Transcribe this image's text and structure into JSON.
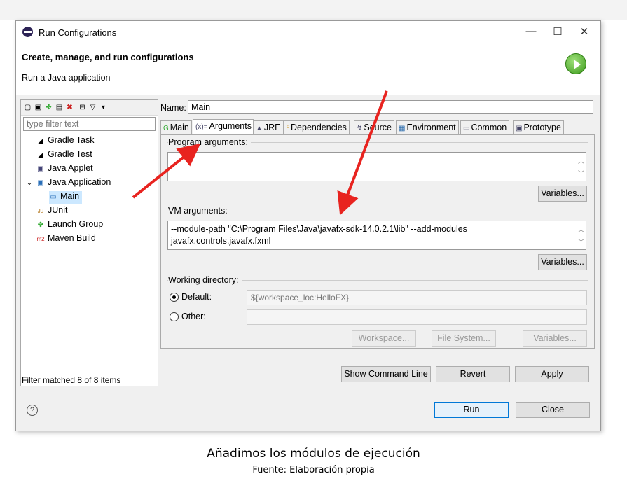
{
  "window": {
    "title": "Run Configurations",
    "minimize": "—",
    "maximize": "☐",
    "close": "✕"
  },
  "header": {
    "title": "Create, manage, and run configurations",
    "subtitle": "Run a Java application"
  },
  "left": {
    "filter_placeholder": "type filter text",
    "items": [
      {
        "label": "Gradle Task",
        "icon": "gradle-task-icon",
        "glyph": "◢"
      },
      {
        "label": "Gradle Test",
        "icon": "gradle-test-icon",
        "glyph": "◢"
      },
      {
        "label": "Java Applet",
        "icon": "java-applet-icon",
        "glyph": "▣"
      },
      {
        "label": "Java Application",
        "icon": "java-application-icon",
        "glyph": "▣",
        "expander": "⌄"
      },
      {
        "label": "Main",
        "icon": "java-main-icon",
        "glyph": "▭"
      },
      {
        "label": "JUnit",
        "icon": "junit-icon",
        "glyph": "Ju"
      },
      {
        "label": "Launch Group",
        "icon": "launch-group-icon",
        "glyph": "✤"
      },
      {
        "label": "Maven Build",
        "icon": "maven-icon",
        "glyph": "m2"
      }
    ],
    "status": "Filter matched 8 of 8 items"
  },
  "config": {
    "name_label": "Name:",
    "name_value": "Main",
    "tabs": [
      {
        "label": "Main",
        "glyph": "G"
      },
      {
        "label": "Arguments",
        "glyph": "(x)="
      },
      {
        "label": "JRE",
        "glyph": "▲"
      },
      {
        "label": "Dependencies",
        "glyph": "⁰"
      },
      {
        "label": "Source",
        "glyph": "↯"
      },
      {
        "label": "Environment",
        "glyph": "▦"
      },
      {
        "label": "Common",
        "glyph": "▭"
      },
      {
        "label": "Prototype",
        "glyph": "▣"
      }
    ],
    "program_args_label": "Program arguments:",
    "program_args_value": "",
    "variables_label": "Variables...",
    "vm_args_label": "VM arguments:",
    "vm_args_line1": "--module-path \"C:\\Program Files\\Java\\javafx-sdk-14.0.2.1\\lib\" --add-modules",
    "vm_args_line2": "javafx.controls,javafx.fxml",
    "working_dir_label": "Working directory:",
    "default_label": "Default:",
    "default_value": "${workspace_loc:HelloFX}",
    "other_label": "Other:",
    "workspace_btn": "Workspace...",
    "filesystem_btn": "File System...",
    "variables_btn": "Variables..."
  },
  "buttons": {
    "show_command_line": "Show Command Line",
    "revert": "Revert",
    "apply": "Apply",
    "run": "Run",
    "close": "Close",
    "help": "?"
  },
  "caption": {
    "title": "Añadimos los módulos de ejecución",
    "source": "Fuente: Elaboración propia"
  },
  "colors": {
    "arrow": "#e8231f",
    "selection": "#cce8ff",
    "primary_border": "#0078d7"
  }
}
